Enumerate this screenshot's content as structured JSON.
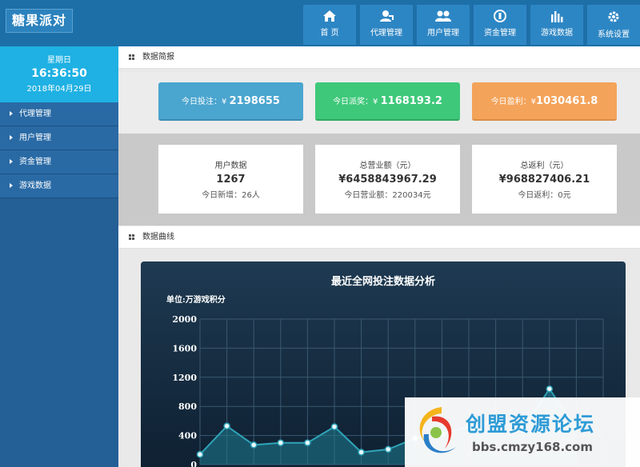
{
  "app": {
    "logo": "糖果派对"
  },
  "nav": [
    {
      "label": "首 页",
      "icon": "home-icon"
    },
    {
      "label": "代理管理",
      "icon": "agent-user-icon"
    },
    {
      "label": "用户管理",
      "icon": "users-icon"
    },
    {
      "label": "资金管理",
      "icon": "coin-icon"
    },
    {
      "label": "游戏数据",
      "icon": "bar-chart-icon"
    },
    {
      "label": "系统设置",
      "icon": "gear-icon"
    }
  ],
  "clock": {
    "weekday": "星期日",
    "time": "16:36:50",
    "date": "2018年04月29日"
  },
  "sidebar": {
    "items": [
      {
        "label": "代理管理"
      },
      {
        "label": "用户管理"
      },
      {
        "label": "资金管理"
      },
      {
        "label": "游戏数据"
      }
    ]
  },
  "summary": {
    "section_title": "数据简报",
    "bet_label": "今日投注：¥",
    "bet_value": "2198655",
    "payout_label": "今日派奖：¥",
    "payout_value": "1168193.2",
    "profit_label": "今日盈利：¥",
    "profit_value": "1030461.8"
  },
  "cards": [
    {
      "title": "用户数据",
      "value": "1267",
      "sub": "今日新增：26人"
    },
    {
      "title": "总营业额（元）",
      "value": "¥6458843967.29",
      "sub": "今日营业额：220034元"
    },
    {
      "title": "总返利（元）",
      "value": "¥968827406.21",
      "sub": "今日返利：0元"
    }
  ],
  "chart_section": {
    "title": "数据曲线"
  },
  "chart_data": {
    "type": "area",
    "title": "最近全网投注数据分析",
    "ylabel": "单位:万游戏积分",
    "ylim": [
      0,
      2000
    ],
    "yticks": [
      0,
      400,
      800,
      1200,
      1600,
      2000
    ],
    "values": [
      140,
      530,
      270,
      300,
      300,
      520,
      170,
      210,
      360,
      420,
      520,
      600,
      480,
      1040,
      500
    ],
    "grid": true,
    "colors": {
      "line": "#2fa4b8",
      "fill": "#1f7e92",
      "point_fill": "#e8f7fb"
    }
  },
  "watermark": {
    "text": "创盟资源论坛",
    "url": "bbs.cmzy168.com"
  }
}
